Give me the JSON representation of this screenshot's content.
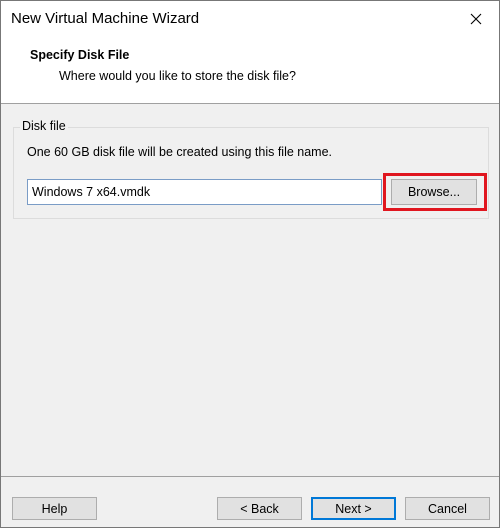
{
  "window": {
    "title": "New Virtual Machine Wizard",
    "close_icon": "close-icon"
  },
  "header": {
    "title": "Specify Disk File",
    "subtitle": "Where would you like to store the disk file?"
  },
  "disk_group": {
    "legend": "Disk file",
    "description": "One 60 GB disk file will be created using this file name.",
    "file_name_value": "Windows 7 x64.vmdk",
    "browse_label": "Browse...",
    "highlight_color": "#e0161f"
  },
  "footer": {
    "help_label": "Help",
    "back_label": "< Back",
    "next_label": "Next >",
    "cancel_label": "Cancel"
  }
}
